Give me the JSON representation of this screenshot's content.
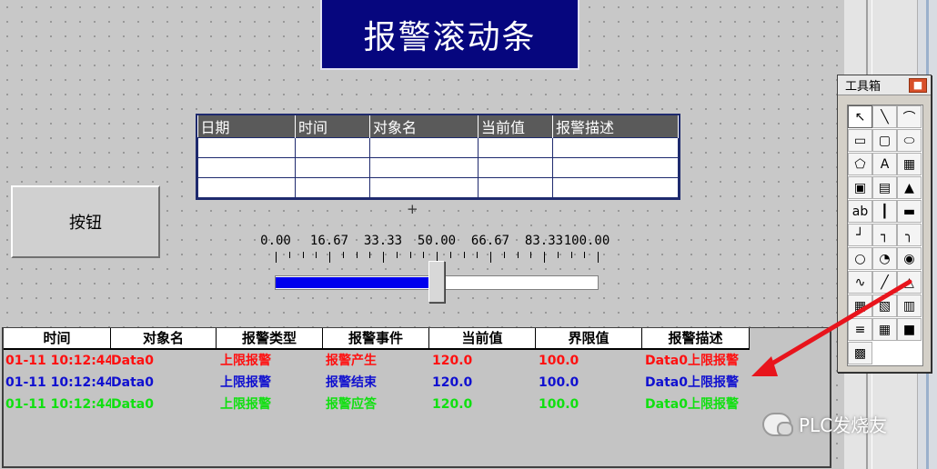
{
  "title_banner": "报警滚动条",
  "info_table": {
    "headers": [
      "日期",
      "时间",
      "对象名",
      "当前值",
      "报警描述"
    ],
    "row_count": 3
  },
  "button_label": "按钮",
  "plus_marker": "+",
  "slider": {
    "tick_labels": [
      "0.00",
      "16.67",
      "33.33",
      "50.00",
      "66.67",
      "83.33",
      "100.00"
    ],
    "value": 50.0,
    "min": 0,
    "max": 100,
    "fill_color": "#0000ee"
  },
  "alarm_table": {
    "headers": [
      "时间",
      "对象名",
      "报警类型",
      "报警事件",
      "当前值",
      "界限值",
      "报警描述"
    ],
    "rows": [
      {
        "time": "01-11 10:12:44",
        "object": "Data0",
        "type": "上限报警",
        "event": "报警产生",
        "current": "120.0",
        "limit": "100.0",
        "desc": "Data0上限报警",
        "color": "#ff1010"
      },
      {
        "time": "01-11 10:12:44",
        "object": "Data0",
        "type": "上限报警",
        "event": "报警结束",
        "current": "120.0",
        "limit": "100.0",
        "desc": "Data0上限报警",
        "color": "#1010d0"
      },
      {
        "time": "01-11 10:12:44",
        "object": "Data0",
        "type": "上限报警",
        "event": "报警应答",
        "current": "120.0",
        "limit": "100.0",
        "desc": "Data0上限报警",
        "color": "#10e010"
      }
    ]
  },
  "toolbox": {
    "title": "工具箱",
    "tools": [
      "pointer-icon",
      "line-icon",
      "arc-icon",
      "rectangle-icon",
      "rounded-rect-icon",
      "ellipse-icon",
      "polygon-icon",
      "text-label-icon",
      "bitmap-icon",
      "symbol-library-icon",
      "insert-element-icon",
      "save-element-icon",
      "input-box-icon",
      "flow-pipe-icon",
      "flow-block-icon",
      "line-connector-icon",
      "fold-line-icon",
      "arc-connector-icon",
      "rotary-icon",
      "gauge-icon",
      "toggle-icon",
      "trend-curve-icon",
      "history-curve-icon",
      "alarm-display-icon",
      "report-table-icon",
      "custom-window-icon",
      "subwindow-icon",
      "strip-bar-icon",
      "data-table-icon",
      "frame-icon",
      "picture-icon"
    ]
  },
  "watermark": "PLC发烧友"
}
